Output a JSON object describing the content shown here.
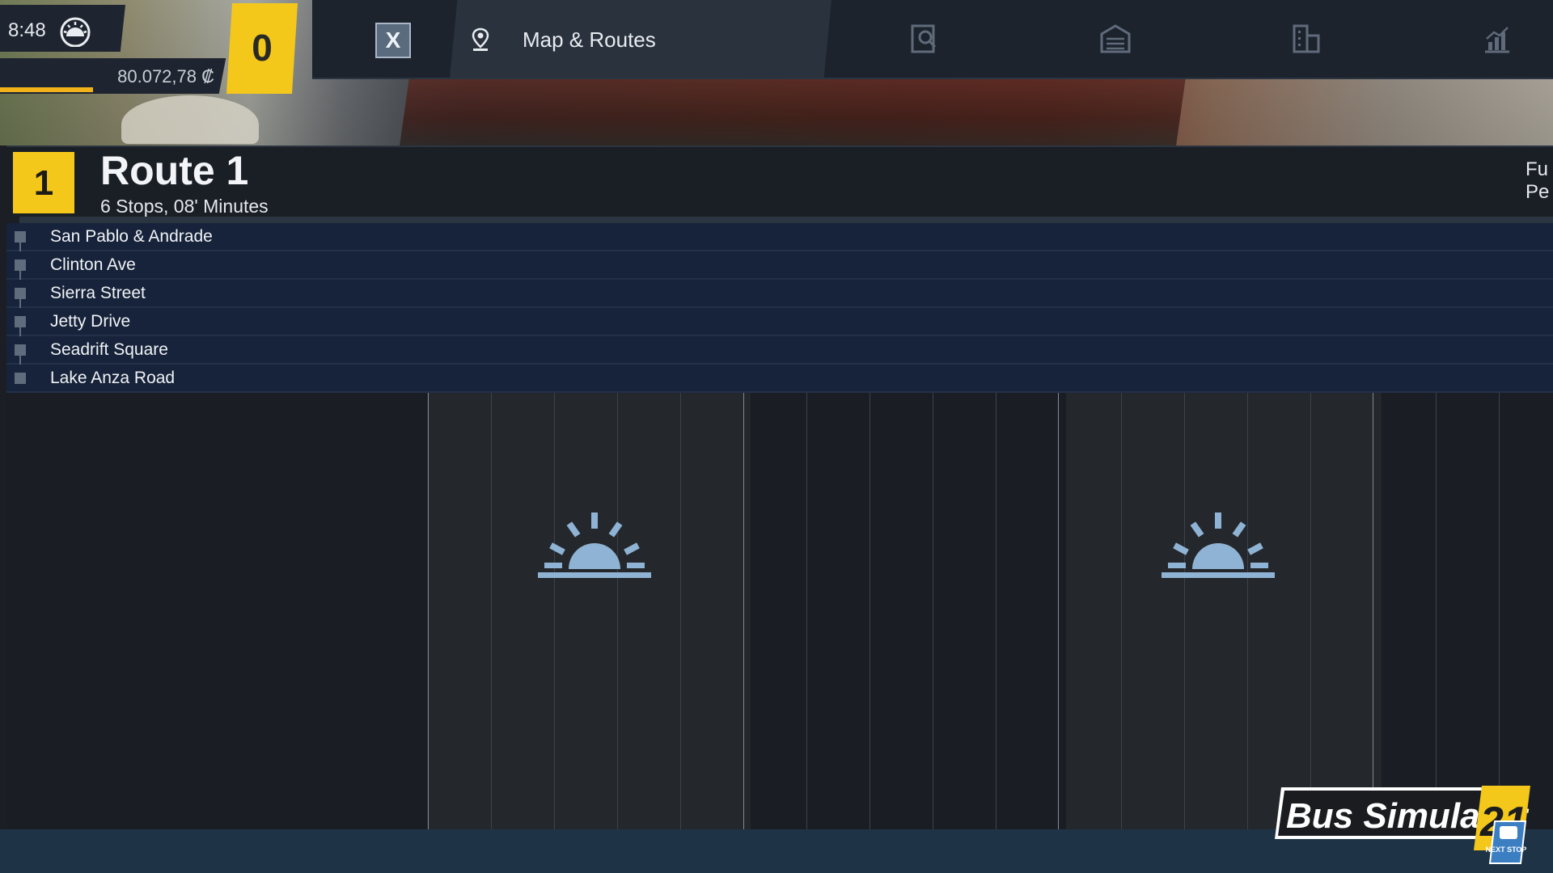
{
  "hud": {
    "time": "8:48",
    "weather_icon": "sunrise-icon",
    "money": "80.072,78 ₡",
    "counter": "0",
    "progress_fraction": 0.06
  },
  "tabs": {
    "close_label": "X",
    "active_label": "Map & Routes",
    "icons": [
      "search-document-icon",
      "depot-icon",
      "buildings-icon",
      "statistics-icon"
    ]
  },
  "route": {
    "number": "1",
    "title": "Route 1",
    "subtitle": "6 Stops, 08' Minutes",
    "right_text_line1": "Fu",
    "right_text_line2": "Pe"
  },
  "stops": [
    {
      "name": "San Pablo & Andrade"
    },
    {
      "name": "Clinton Ave"
    },
    {
      "name": "Sierra Street"
    },
    {
      "name": "Jetty Drive"
    },
    {
      "name": "Seadrift Square"
    },
    {
      "name": "Lake Anza Road"
    }
  ],
  "logo": {
    "text": "Bus Simulator",
    "number": "21",
    "badge": "NEXT STOP"
  },
  "colors": {
    "accent_yellow": "#f4c81b",
    "progress_orange": "#f1b21a",
    "sun_blue": "#8fb3d4"
  }
}
